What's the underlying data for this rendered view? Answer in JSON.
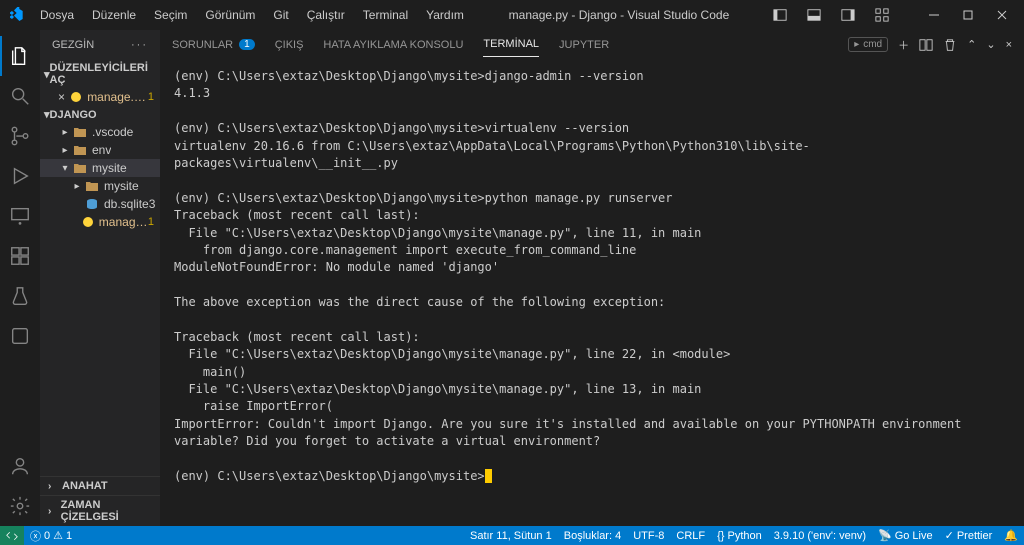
{
  "titlebar": {
    "menu": [
      "Dosya",
      "Düzenle",
      "Seçim",
      "Görünüm",
      "Git",
      "Çalıştır",
      "Terminal",
      "Yardım"
    ],
    "title": "manage.py - Django - Visual Studio Code"
  },
  "sidebar": {
    "header": "GEZGİN",
    "open_editors": "DÜZENLEYİCİLERİ AÇ",
    "project": "DJANGO",
    "open_file": {
      "name": "manage.py...",
      "badge": "1"
    },
    "tree": [
      {
        "name": ".vscode",
        "type": "folder",
        "depth": 1
      },
      {
        "name": "env",
        "type": "folder",
        "depth": 1
      },
      {
        "name": "mysite",
        "type": "folder",
        "depth": 1,
        "expanded": true,
        "selected": true
      },
      {
        "name": "mysite",
        "type": "folder",
        "depth": 2
      },
      {
        "name": "db.sqlite3",
        "type": "file-db",
        "depth": 2
      },
      {
        "name": "manage.py",
        "type": "file-py",
        "depth": 2,
        "modified": true,
        "badge": "1"
      }
    ],
    "collapsed": [
      "ANAHAT",
      "ZAMAN ÇİZELGESİ"
    ]
  },
  "panel": {
    "tabs": [
      {
        "label": "SORUNLAR",
        "badge": "1"
      },
      {
        "label": "ÇIKIŞ"
      },
      {
        "label": "HATA AYIKLAMA KONSOLU"
      },
      {
        "label": "TERMİNAL",
        "active": true
      },
      {
        "label": "JUPYTER"
      }
    ],
    "shell": "cmd"
  },
  "terminal": {
    "lines": [
      "(env) C:\\Users\\extaz\\Desktop\\Django\\mysite>django-admin --version",
      "4.1.3",
      "",
      "(env) C:\\Users\\extaz\\Desktop\\Django\\mysite>virtualenv --version",
      "virtualenv 20.16.6 from C:\\Users\\extaz\\AppData\\Local\\Programs\\Python\\Python310\\lib\\site-packages\\virtualenv\\__init__.py",
      "",
      "(env) C:\\Users\\extaz\\Desktop\\Django\\mysite>python manage.py runserver",
      "Traceback (most recent call last):",
      "  File \"C:\\Users\\extaz\\Desktop\\Django\\mysite\\manage.py\", line 11, in main",
      "    from django.core.management import execute_from_command_line",
      "ModuleNotFoundError: No module named 'django'",
      "",
      "The above exception was the direct cause of the following exception:",
      "",
      "Traceback (most recent call last):",
      "  File \"C:\\Users\\extaz\\Desktop\\Django\\mysite\\manage.py\", line 22, in <module>",
      "    main()",
      "  File \"C:\\Users\\extaz\\Desktop\\Django\\mysite\\manage.py\", line 13, in main",
      "    raise ImportError(",
      "ImportError: Couldn't import Django. Are you sure it's installed and available on your PYTHONPATH environment variable? Did you forget to activate a virtual environment?",
      ""
    ],
    "prompt": "(env) C:\\Users\\extaz\\Desktop\\Django\\mysite>"
  },
  "statusbar": {
    "errors": "0",
    "warnings": "1",
    "cursor": "Satır 11, Sütun 1",
    "spaces": "Boşluklar: 4",
    "encoding": "UTF-8",
    "eol": "CRLF",
    "lang": "Python",
    "interpreter": "3.9.10 ('env': venv)",
    "golive": "Go Live",
    "prettier": "Prettier"
  }
}
